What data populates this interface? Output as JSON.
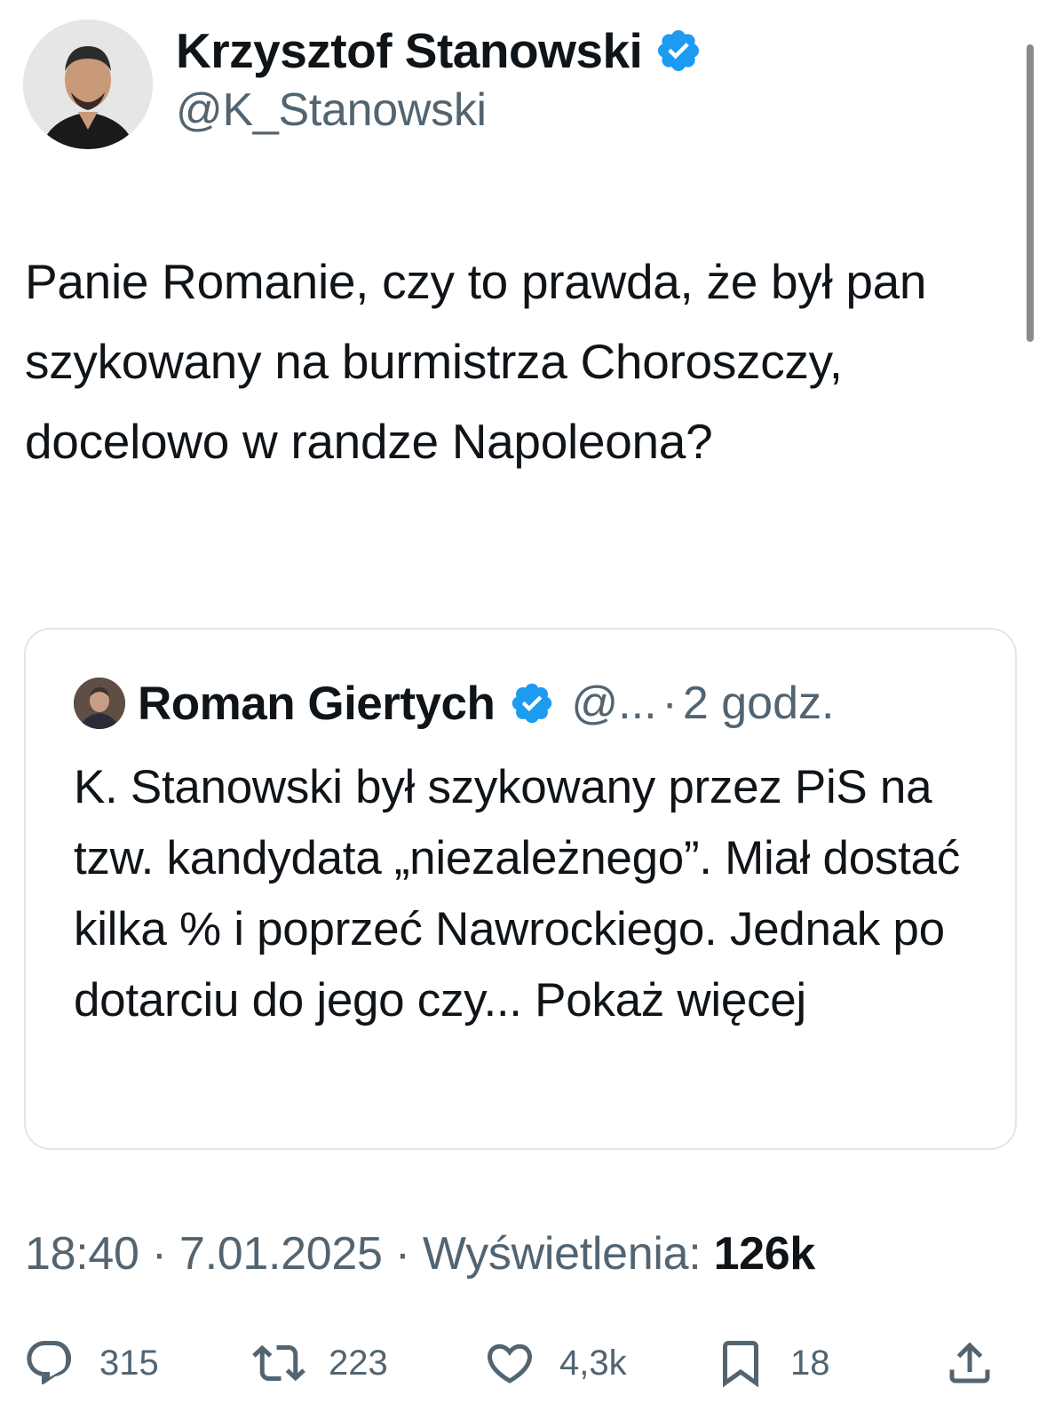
{
  "author": {
    "display_name": "Krzysztof Stanowski",
    "handle": "@K_Stanowski",
    "verified": true
  },
  "tweet": {
    "text": "Panie Romanie, czy to prawda, że był pan szykowany na burmistrza Choroszczy, docelowo w randze Napoleona?"
  },
  "quoted_tweet": {
    "display_name": "Roman Giertych",
    "handle": "@...",
    "separator": "·",
    "time_ago": "2 godz.",
    "verified": true,
    "text": "K. Stanowski był szykowany przez PiS na tzw. kandydata „niezależnego”. Miał dostać kilka % i poprzeć Nawrockiego. Jednak po dotarciu do jego czy...",
    "show_more": "Pokaż więcej"
  },
  "meta": {
    "time": "18:40",
    "sep1": " · ",
    "date": "7.01.2025",
    "sep2": " · ",
    "views_label": "Wyświetlenia: ",
    "views_count": "126k"
  },
  "actions": {
    "replies": "315",
    "reposts": "223",
    "likes": "4,3k",
    "bookmarks": "18"
  },
  "icons": {
    "reply": "reply-icon",
    "repost": "repost-icon",
    "like": "heart-icon",
    "bookmark": "bookmark-icon",
    "share": "share-icon",
    "verified": "verified-badge-icon"
  },
  "colors": {
    "verified_blue": "#1d9bf0",
    "text_primary": "#0f1419",
    "text_secondary": "#536471",
    "border": "#e3e6e9"
  }
}
